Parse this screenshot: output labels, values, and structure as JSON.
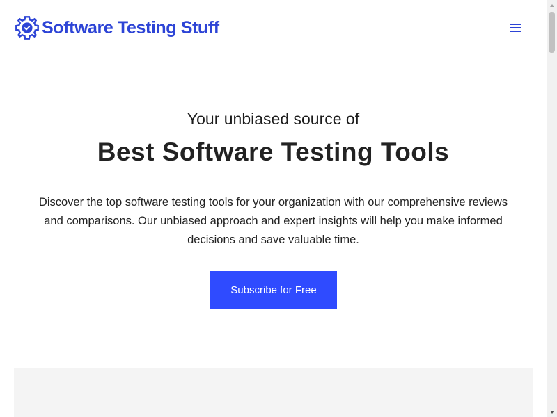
{
  "brand": {
    "name": "Software Testing Stuff",
    "accent_color": "#2d44d6",
    "logo_icon": "gear-check-icon"
  },
  "header": {
    "menu_icon": "hamburger-menu-icon"
  },
  "hero": {
    "eyebrow": "Your unbiased source of",
    "headline": "Best Software Testing Tools",
    "description": "Discover the top software testing tools for your organization with our comprehensive reviews and comparisons. Our unbiased approach and expert insights will help you make informed decisions and save valuable time.",
    "cta_label": "Subscribe for Free",
    "cta_color": "#2f4bff"
  },
  "scrollbar": {
    "up_icon": "scroll-up-arrow-icon",
    "down_icon": "scroll-down-arrow-icon"
  }
}
